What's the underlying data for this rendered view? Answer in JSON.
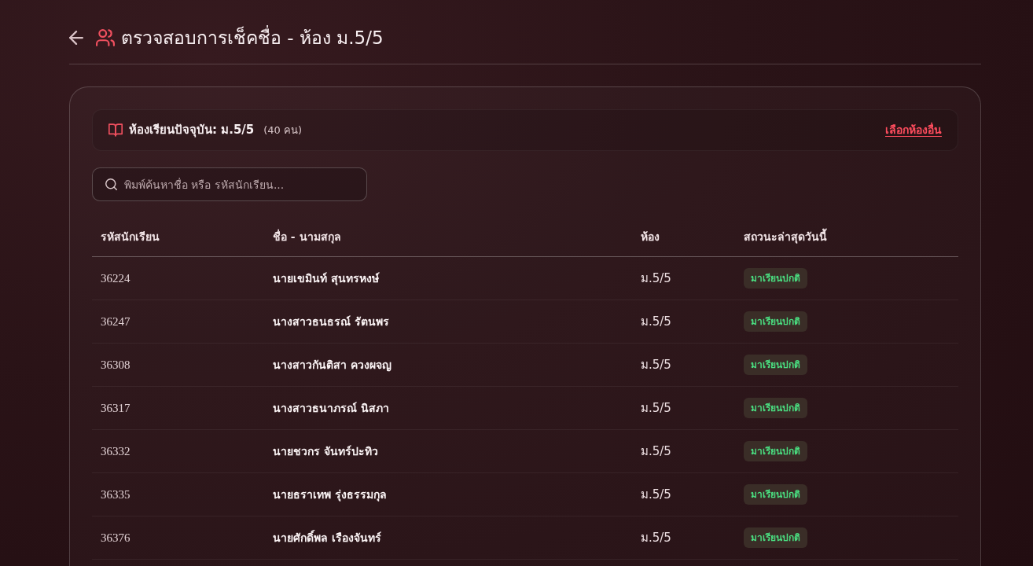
{
  "header": {
    "title": "ตรวจสอบการเช็คชื่อ - ห้อง ม.5/5"
  },
  "class_info": {
    "label": "ห้องเรียนปัจจุบัน: ม.5/5",
    "count": "(40 คน)",
    "change_link": "เลือกห้องอื่น"
  },
  "search": {
    "placeholder": "พิมพ์ค้นหาชื่อ หรือ รหัสนักเรียน..."
  },
  "table": {
    "columns": [
      "รหัสนักเรียน",
      "ชื่อ - นามสกุล",
      "ห้อง",
      "สถวนะล่าสุดวันนี้"
    ],
    "rows": [
      {
        "student_id": "36224",
        "name": "นายเขมินท์ สุนทรหงษ์",
        "room": "ม.5/5",
        "status": {
          "text": "มาเรียนปกติ",
          "kind": "present"
        }
      },
      {
        "student_id": "36247",
        "name": "นางสาวธนธรณ์ รัตนพร",
        "room": "ม.5/5",
        "status": {
          "text": "มาเรียนปกติ",
          "kind": "present"
        }
      },
      {
        "student_id": "36308",
        "name": "นางสาวกันติสา ควงผจญ",
        "room": "ม.5/5",
        "status": {
          "text": "มาเรียนปกติ",
          "kind": "present"
        }
      },
      {
        "student_id": "36317",
        "name": "นางสาวธนาภรณ์ นิสภา",
        "room": "ม.5/5",
        "status": {
          "text": "มาเรียนปกติ",
          "kind": "present"
        }
      },
      {
        "student_id": "36332",
        "name": "นายชวกร จันทร์ปะทิว",
        "room": "ม.5/5",
        "status": {
          "text": "มาเรียนปกติ",
          "kind": "present"
        }
      },
      {
        "student_id": "36335",
        "name": "นายธราเทพ รุ่งธรรมกุล",
        "room": "ม.5/5",
        "status": {
          "text": "มาเรียนปกติ",
          "kind": "present"
        }
      },
      {
        "student_id": "36376",
        "name": "นายศักดิ์พล เรืองจันทร์",
        "room": "ม.5/5",
        "status": {
          "text": "มาเรียนปกติ",
          "kind": "present"
        }
      }
    ]
  }
}
